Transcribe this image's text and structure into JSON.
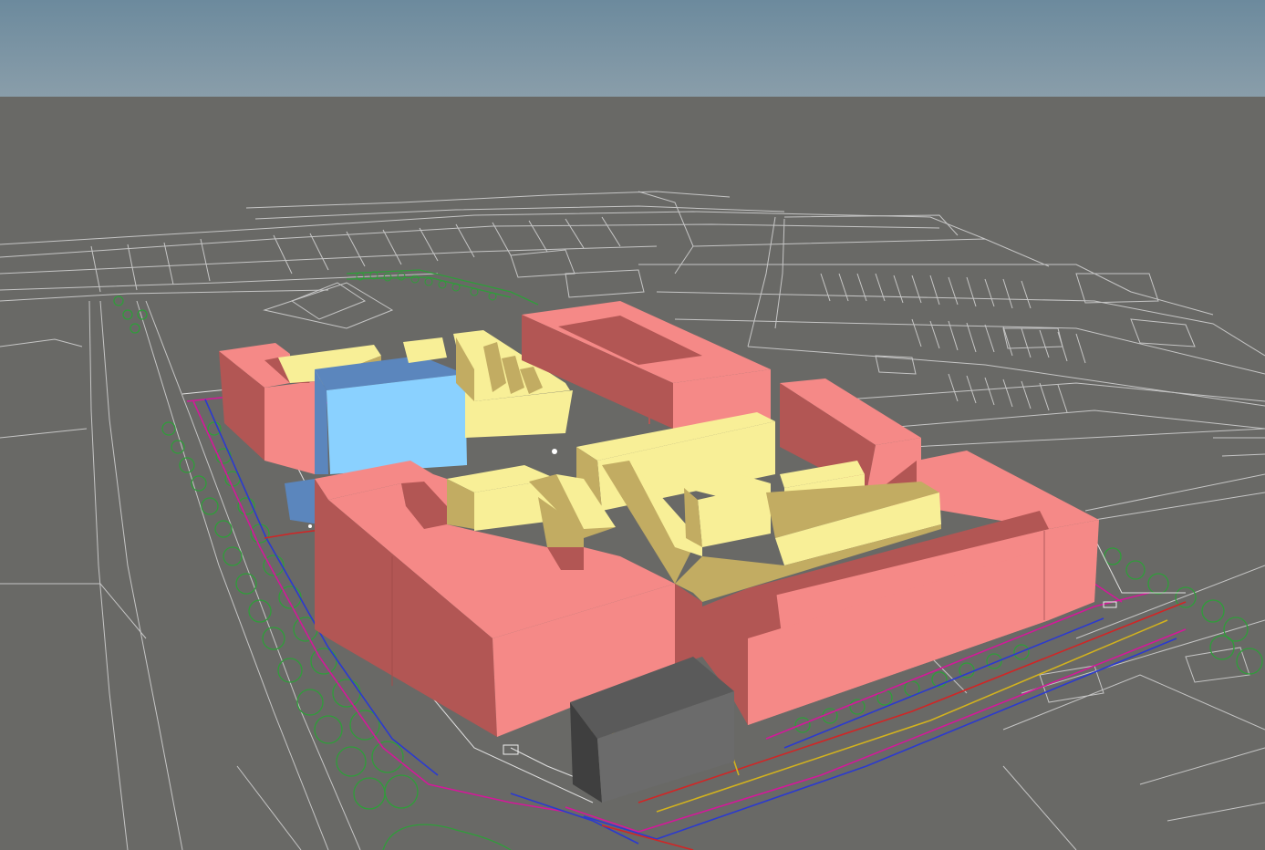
{
  "scene": {
    "sky_top_color": "#6c8a9d",
    "sky_bottom_color": "#8a9eaa",
    "ground_color": "#696966",
    "linework_color": "#d6d6d6",
    "tree_color": "#2f9e3a",
    "road_line_colors": [
      "#d4189a",
      "#2b3ad0",
      "#d22525",
      "#d2b21e"
    ]
  },
  "legend_colors": {
    "perimeter_block": "#f58987",
    "perimeter_block_shade": "#b25654",
    "inner_block": "#f8ef97",
    "inner_block_shade": "#c2ac62",
    "tall_block": "#8ad1ff",
    "tall_block_shade": "#5b86bd",
    "service_block": "#5a5a5a",
    "service_block_shade": "#3f3f3f"
  }
}
